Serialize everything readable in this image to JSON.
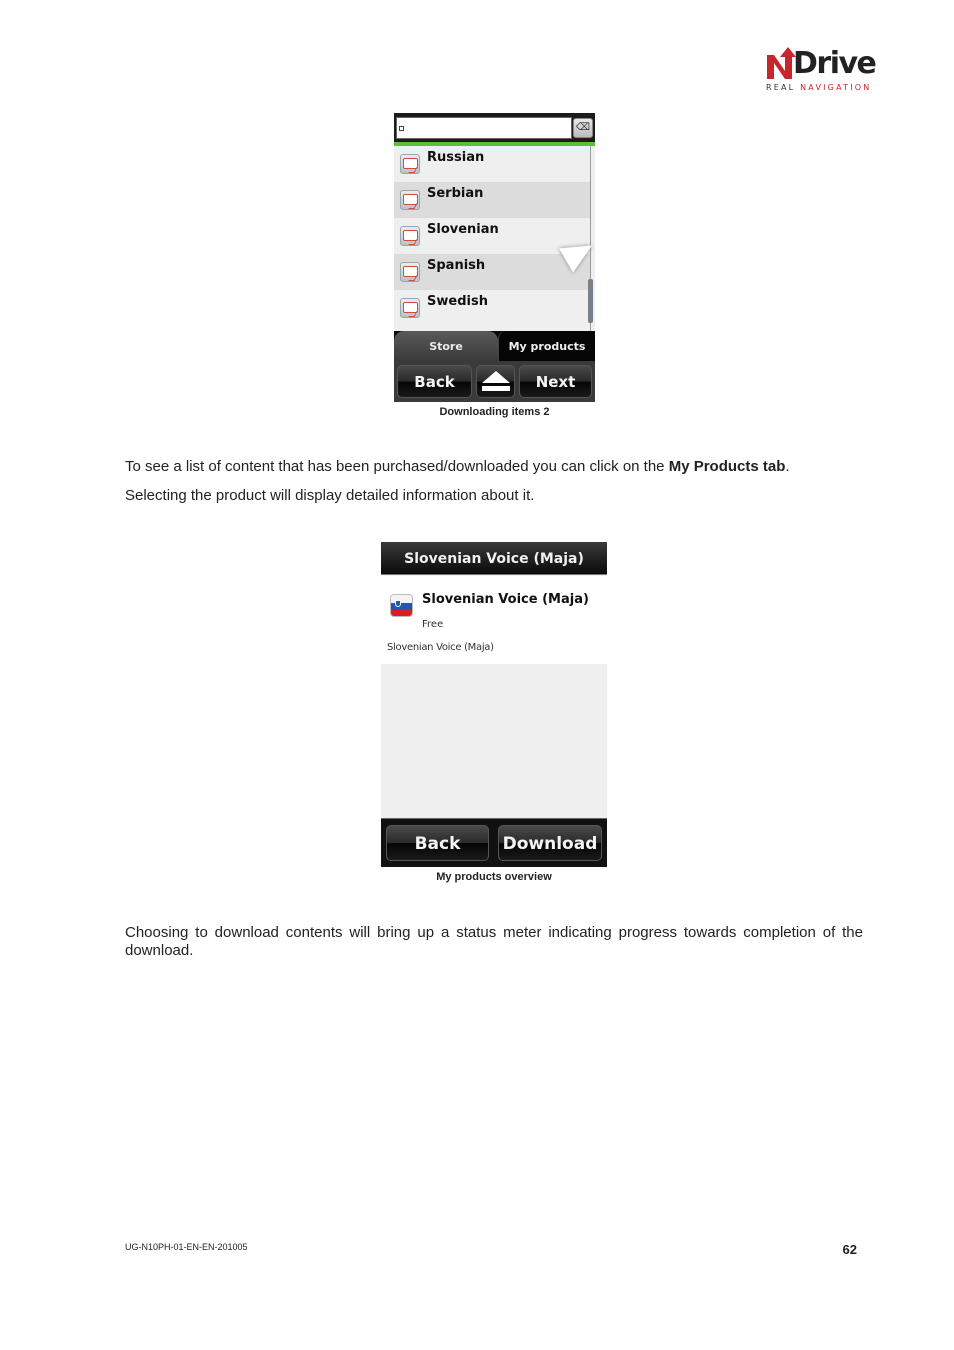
{
  "logo": {
    "brand": "Drive",
    "brand_initial": "N",
    "tagline_part1": "REAL",
    "tagline_part2": "NAVIGATION",
    "colors": {
      "red": "#c8262c",
      "dark": "#222222"
    }
  },
  "screenshot1": {
    "search": {
      "value": "",
      "clear_icon": "backspace-icon"
    },
    "accent_color": "#5bbf3a",
    "list_items": [
      {
        "label": "Russian",
        "icon": "voice-speech-icon"
      },
      {
        "label": "Serbian",
        "icon": "voice-speech-icon"
      },
      {
        "label": "Slovenian",
        "icon": "voice-speech-icon"
      },
      {
        "label": "Spanish",
        "icon": "voice-speech-icon"
      },
      {
        "label": "Swedish",
        "icon": "voice-speech-icon"
      }
    ],
    "tabs": {
      "store": "Store",
      "my_products": "My products"
    },
    "buttons": {
      "back": "Back",
      "eject_icon": "eject-icon",
      "next": "Next"
    },
    "caption": "Downloading items 2"
  },
  "paragraph1": {
    "line1_pre": "To see a list of content that has been purchased/downloaded you can click on the ",
    "line1_bold": "My Products tab",
    "line1_post": ".",
    "line2": "Selecting the product will display detailed information about it."
  },
  "screenshot2": {
    "title": "Slovenian Voice (Maja)",
    "product": {
      "name": "Slovenian Voice (Maja)",
      "price": "Free",
      "description": "Slovenian Voice (Maja)",
      "icon": "slovenia-flag-icon"
    },
    "buttons": {
      "back": "Back",
      "download": "Download"
    },
    "caption": "My products overview"
  },
  "paragraph2": "Choosing to download contents will bring up a status meter indicating progress towards completion of the download.",
  "footer": {
    "doc_code": "UG-N10PH-01-EN-EN-201005",
    "page_number": "62"
  }
}
